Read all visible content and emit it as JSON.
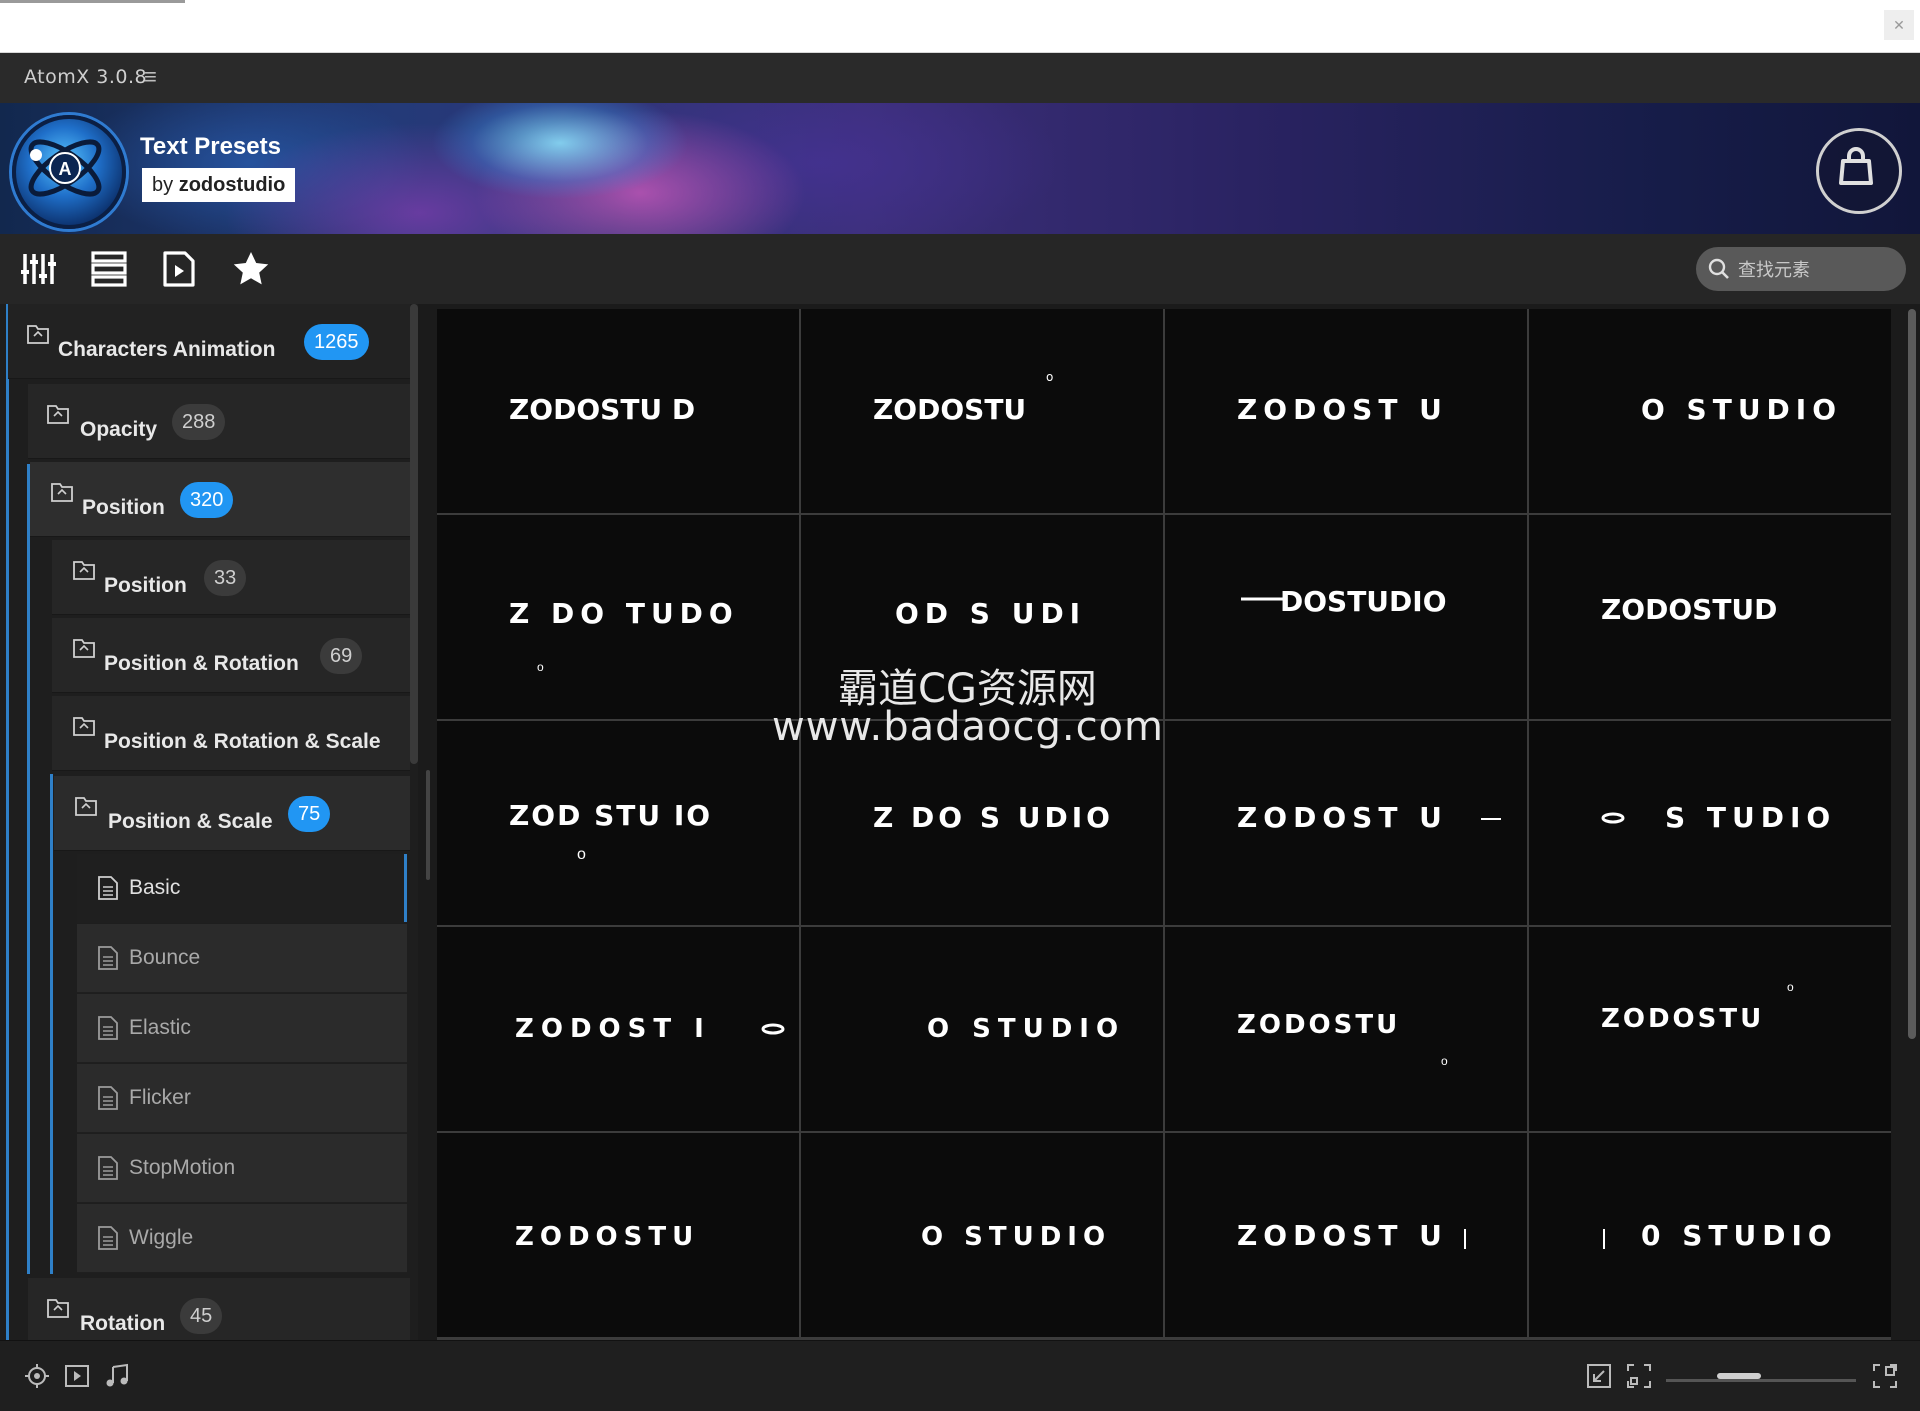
{
  "app": {
    "title": "AtomX 3.0.8",
    "menu_icon": "hamburger-icon"
  },
  "banner": {
    "title": "Text Presets",
    "by": "by",
    "author": "zodostudio"
  },
  "toolbar": {
    "icons": [
      "sliders-icon",
      "list-icon",
      "media-file-icon",
      "star-icon"
    ],
    "search_placeholder": "查找元素"
  },
  "sidebar": {
    "root": {
      "label": "Characters Animation",
      "count": "1265"
    },
    "opacity": {
      "label": "Opacity",
      "count": "288"
    },
    "position": {
      "label": "Position",
      "count": "320"
    },
    "position_sub": {
      "label": "Position",
      "count": "33"
    },
    "position_rotation": {
      "label": "Position & Rotation",
      "count": "69"
    },
    "position_rotation_scale": {
      "label": "Position & Rotation & Scale"
    },
    "position_scale": {
      "label": "Position & Scale",
      "count": "75"
    },
    "leaves": [
      "Basic",
      "Bounce",
      "Elastic",
      "Flicker",
      "StopMotion",
      "Wiggle"
    ],
    "rotation": {
      "label": "Rotation",
      "count": "45"
    }
  },
  "grid": {
    "cells": [
      {
        "text": "ZODOSTU D"
      },
      {
        "text": "ZODOSTU"
      },
      {
        "text": "ZODOST U"
      },
      {
        "text": "O STUDIO"
      },
      {
        "text": "Z DO TUDO"
      },
      {
        "text": "OD S UDI"
      },
      {
        "text": "DOSTUDIO"
      },
      {
        "text": "ZODOSTUD"
      },
      {
        "text": "ZOD STU IO"
      },
      {
        "text": "Z DO S UDIO"
      },
      {
        "text": "ZODOST U"
      },
      {
        "text": "S TUDIO"
      },
      {
        "text": "ZODOST I"
      },
      {
        "text": "O STUDIO"
      },
      {
        "text": "ZODOSTU"
      },
      {
        "text": "ZODOSTU"
      },
      {
        "text": "ZODOSTU"
      },
      {
        "text": "O STUDIO"
      },
      {
        "text": "ZODOST U"
      },
      {
        "text": "0 STUDIO"
      }
    ]
  },
  "watermark": {
    "cn": "霸道CG资源网",
    "url": "www.badaocg.com"
  },
  "status": {
    "left_icons": [
      "target-icon",
      "play-frame-icon",
      "music-note-icon"
    ],
    "right_icons": [
      "import-icon",
      "fit-icon",
      "expand-icon"
    ],
    "zoom": 0.35
  },
  "colors": {
    "accent": "#2196f3",
    "tree_line": "#2f80c8"
  }
}
